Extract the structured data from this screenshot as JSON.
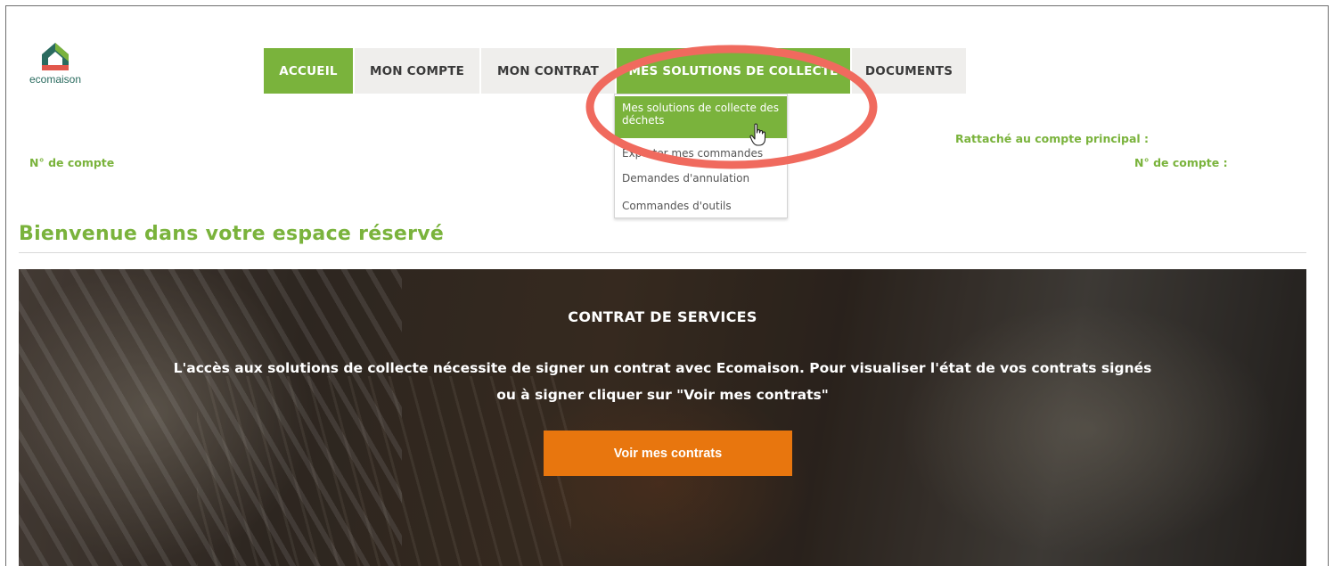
{
  "brand": {
    "name": "ecomaison"
  },
  "nav": {
    "items": [
      {
        "label": "ACCUEIL",
        "active": true
      },
      {
        "label": "MON COMPTE",
        "active": false
      },
      {
        "label": "MON CONTRAT",
        "active": false
      },
      {
        "label": "MES SOLUTIONS DE COLLECTE",
        "active": true
      },
      {
        "label": "DOCUMENTS",
        "active": false
      }
    ]
  },
  "dropdown": {
    "items": [
      {
        "label": "Mes solutions de collecte des déchets",
        "hovered": true
      },
      {
        "label": "Exporter mes commandes",
        "hovered": false
      },
      {
        "label": "Demandes d'annulation",
        "hovered": false
      },
      {
        "label": "Commandes d'outils",
        "hovered": false
      }
    ]
  },
  "account": {
    "left_label": "N° de compte",
    "attached_label": "Rattaché au compte principal :",
    "right_label": "N° de compte :"
  },
  "welcome_title": "Bienvenue dans votre espace réservé",
  "banner": {
    "title": "CONTRAT DE SERVICES",
    "text": "L'accès aux solutions de collecte nécessite de signer un contrat avec Ecomaison. Pour visualiser l'état de vos contrats signés ou à signer cliquer sur \"Voir mes contrats\"",
    "button_label": "Voir mes contrats"
  },
  "colors": {
    "accent_green": "#7ab33c",
    "button_orange": "#e8760e",
    "highlight_ring": "#f06a5e"
  }
}
